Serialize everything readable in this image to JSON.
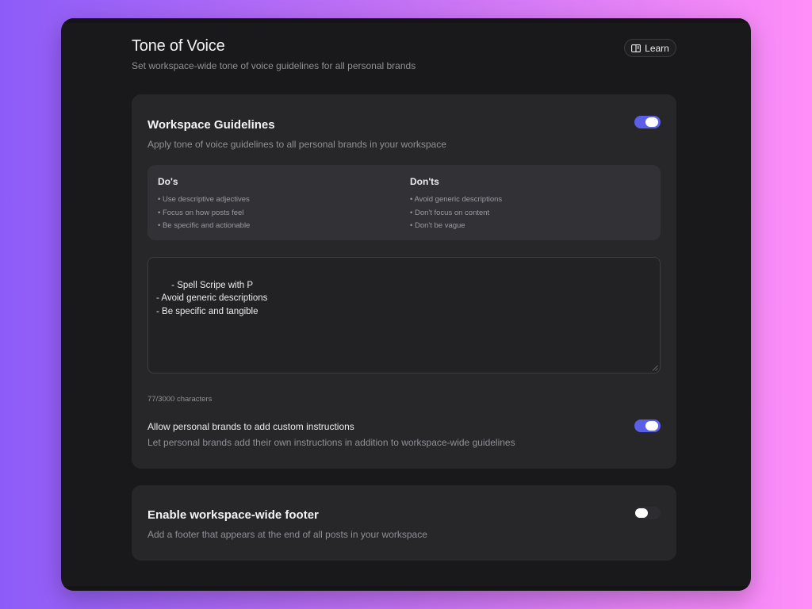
{
  "header": {
    "title": "Tone of Voice",
    "subtitle": "Set workspace-wide tone of voice guidelines for all personal brands",
    "learn_label": "Learn"
  },
  "guidelines": {
    "title": "Workspace Guidelines",
    "description": "Apply tone of voice guidelines to all personal brands in your workspace",
    "enabled": true,
    "dos": {
      "title": "Do's",
      "items": [
        "• Use descriptive adjectives",
        "• Focus on how posts feel",
        "• Be specific and actionable"
      ]
    },
    "donts": {
      "title": "Don'ts",
      "items": [
        "• Avoid generic descriptions",
        "• Don't focus on content",
        "• Don't be vague"
      ]
    },
    "textarea_value": "- Spell Scripe with P\n- Avoid generic descriptions\n- Be specific and tangible",
    "char_count": "77/3000 characters",
    "custom_instructions": {
      "title": "Allow personal brands to add custom instructions",
      "description": "Let personal brands add their own instructions in addition to workspace-wide guidelines",
      "enabled": true
    }
  },
  "footer_setting": {
    "title": "Enable workspace-wide footer",
    "description": "Add a footer that appears at the end of all posts in your workspace",
    "enabled": false
  },
  "colors": {
    "accent": "#5b5ee6",
    "window_bg": "#19191b",
    "card_bg": "#27272a"
  },
  "icons": {
    "learn": "book-icon",
    "grip": "resize-grip-icon"
  }
}
